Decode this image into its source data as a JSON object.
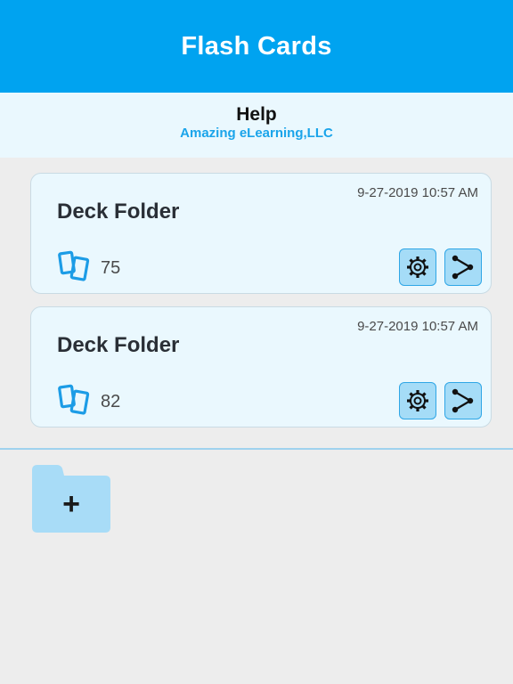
{
  "header": {
    "title": "Flash Cards"
  },
  "help": {
    "title": "Help",
    "subtitle": "Amazing eLearning,LLC"
  },
  "decks": [
    {
      "name": "Deck Folder",
      "date": "9-27-2019 10:57 AM",
      "count": "75"
    },
    {
      "name": "Deck Folder",
      "date": "9-27-2019 10:57 AM",
      "count": "82"
    }
  ],
  "add_folder": {
    "label": "+"
  },
  "icons": {
    "cards": "cards-icon",
    "settings": "gear-icon",
    "share": "share-icon",
    "folder": "folder-icon"
  },
  "colors": {
    "header_bg": "#00a3f0",
    "help_bg": "#eaf8fe",
    "accent": "#1aa4ea",
    "button_bg": "#a5dcf7",
    "folder": "#a8dcf7",
    "page_bg": "#ededed"
  }
}
